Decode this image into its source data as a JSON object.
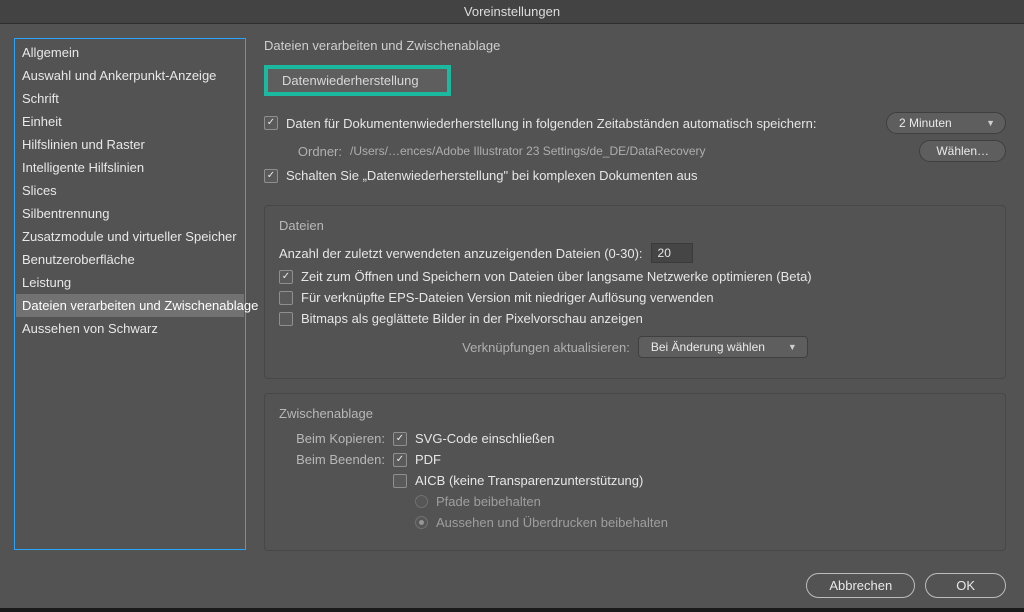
{
  "window": {
    "title": "Voreinstellungen"
  },
  "sidebar": {
    "items": [
      "Allgemein",
      "Auswahl und Ankerpunkt-Anzeige",
      "Schrift",
      "Einheit",
      "Hilfslinien und Raster",
      "Intelligente Hilfslinien",
      "Slices",
      "Silbentrennung",
      "Zusatzmodule und virtueller Speicher",
      "Benutzeroberfläche",
      "Leistung",
      "Dateien verarbeiten und Zwischenablage",
      "Aussehen von Schwarz"
    ],
    "selected_index": 11
  },
  "main": {
    "title": "Dateien verarbeiten und Zwischenablage",
    "recovery": {
      "section_label": "Datenwiederherstellung",
      "auto_save_label": "Daten für Dokumentenwiederherstellung in folgenden Zeitabständen automatisch speichern:",
      "auto_save_checked": true,
      "interval_selected": "2 Minuten",
      "choose_button": "Wählen…",
      "folder_label": "Ordner:",
      "folder_path": "/Users/…ences/Adobe Illustrator 23 Settings/de_DE/DataRecovery",
      "disable_complex_label": "Schalten Sie „Datenwiederherstellung\" bei komplexen Dokumenten aus",
      "disable_complex_checked": true
    },
    "files": {
      "group_title": "Dateien",
      "recent_label": "Anzahl der zuletzt verwendeten anzuzeigenden Dateien (0-30):",
      "recent_value": "20",
      "slow_network_label": "Zeit zum Öffnen und Speichern von Dateien über langsame Netzwerke optimieren (Beta)",
      "slow_network_checked": true,
      "eps_lowres_label": "Für verknüpfte EPS-Dateien Version mit niedriger Auflösung verwenden",
      "eps_lowres_checked": false,
      "bitmap_smooth_label": "Bitmaps als geglättete Bilder in der Pixelvorschau anzeigen",
      "bitmap_smooth_checked": false,
      "update_links_label": "Verknüpfungen aktualisieren:",
      "update_links_value": "Bei Änderung wählen"
    },
    "clipboard": {
      "group_title": "Zwischenablage",
      "on_copy_label": "Beim Kopieren:",
      "svg_label": "SVG-Code einschließen",
      "svg_checked": true,
      "on_quit_label": "Beim Beenden:",
      "pdf_label": "PDF",
      "pdf_checked": true,
      "aicb_label": "AICB (keine Transparenzunterstützung)",
      "aicb_checked": false,
      "radio_paths_label": "Pfade beibehalten",
      "radio_appearance_label": "Aussehen und Überdrucken beibehalten"
    }
  },
  "footer": {
    "cancel": "Abbrechen",
    "ok": "OK"
  }
}
